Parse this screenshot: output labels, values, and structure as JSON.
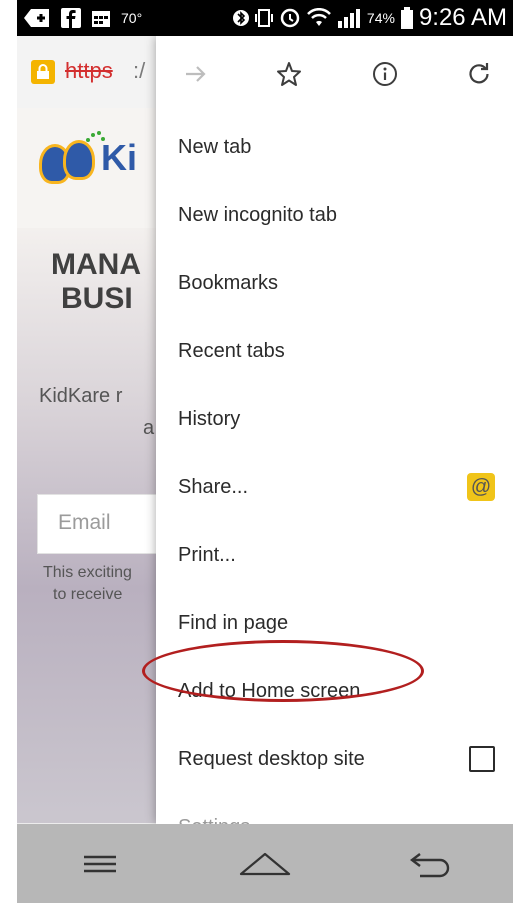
{
  "status_bar": {
    "temperature": "70°",
    "battery_percent": "74%",
    "time": "9:26 AM"
  },
  "url_bar": {
    "scheme": "https",
    "rest": ":/"
  },
  "page": {
    "logo_text": "Ki",
    "hero_title_lines": [
      "MANA",
      "BUSI"
    ],
    "description_lines": [
      "KidKare r",
      "a"
    ],
    "email_placeholder": "Email",
    "note_lines": [
      "This exciting",
      "to receive"
    ]
  },
  "menu": {
    "top_icons": [
      "forward-icon",
      "bookmark-star-icon",
      "page-info-icon",
      "reload-icon"
    ],
    "items": [
      {
        "label": "New tab"
      },
      {
        "label": "New incognito tab"
      },
      {
        "label": "Bookmarks"
      },
      {
        "label": "Recent tabs"
      },
      {
        "label": "History"
      },
      {
        "label": "Share..."
      },
      {
        "label": "Print..."
      },
      {
        "label": "Find in page"
      },
      {
        "label": "Add to Home screen"
      },
      {
        "label": "Request desktop site"
      },
      {
        "label": "Settings"
      }
    ],
    "share_app_glyph": "@",
    "highlight_color": "#b21f1f"
  },
  "nav_bar": {
    "buttons": [
      "menu-icon",
      "home-icon",
      "back-icon"
    ]
  }
}
